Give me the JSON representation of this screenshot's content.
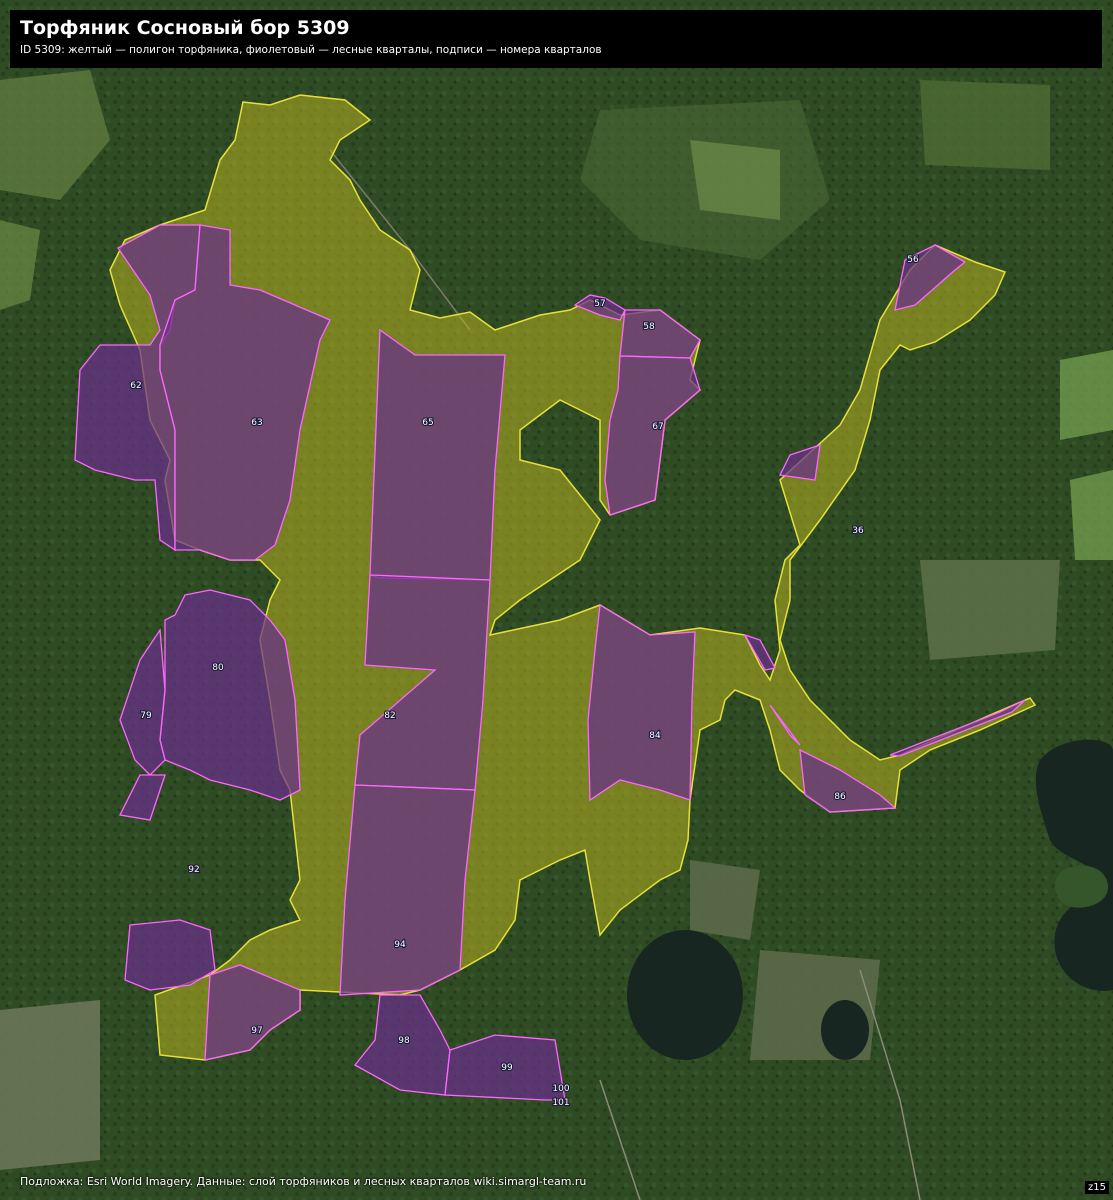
{
  "header": {
    "title": "Торфяник Сосновый бор 5309",
    "subtitle": "ID 5309: желтый — полигон торфяника, фиолетовый — лесные кварталы, подписи — номера кварталов"
  },
  "footer": {
    "attribution": "Подложка: Esri World Imagery. Данные: слой торфяников и лесных кварталов wiki.simargl-team.ru"
  },
  "zoom_label": "z15",
  "colors": {
    "peat_fill": "#b5b020",
    "peat_stroke": "#e8e03a",
    "quarter_fill": "#6a2f8c",
    "quarter_stroke": "#ff66ff",
    "forest": "#2e4a22",
    "water": "#1a2a22"
  },
  "quarter_labels": [
    "56",
    "57",
    "58",
    "62",
    "63",
    "65",
    "67",
    "79",
    "80",
    "82",
    "84",
    "86",
    "92",
    "94",
    "97",
    "98",
    "99",
    "100",
    "101"
  ]
}
